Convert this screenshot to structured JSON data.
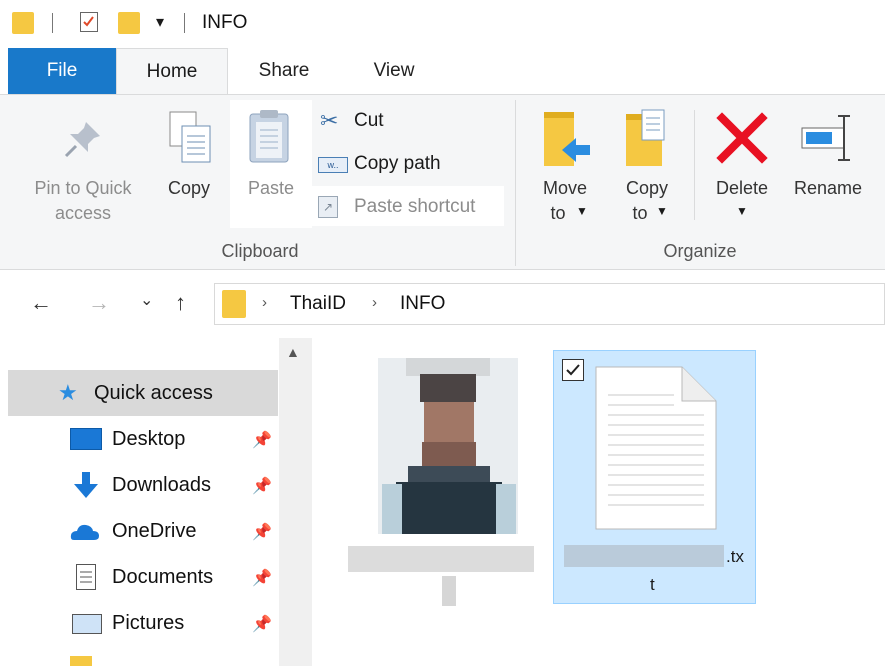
{
  "title": "INFO",
  "tabs": {
    "file": "File",
    "home": "Home",
    "share": "Share",
    "view": "View"
  },
  "ribbon": {
    "pin_quick_access": {
      "line1": "Pin to Quick",
      "line2": "access"
    },
    "copy": "Copy",
    "paste": "Paste",
    "cut": "Cut",
    "copy_path": "Copy path",
    "paste_shortcut": "Paste shortcut",
    "clipboard_group": "Clipboard",
    "move_to": {
      "line1": "Move",
      "line2": "to"
    },
    "copy_to": {
      "line1": "Copy",
      "line2": "to"
    },
    "delete": "Delete",
    "rename": "Rename",
    "organize_group": "Organize"
  },
  "breadcrumb": [
    "ThaiID",
    "INFO"
  ],
  "nav": {
    "quick_access": "Quick access",
    "items": [
      {
        "label": "Desktop",
        "icon": "desktop-icon"
      },
      {
        "label": "Downloads",
        "icon": "downloads-icon"
      },
      {
        "label": "OneDrive",
        "icon": "onedrive-icon"
      },
      {
        "label": "Documents",
        "icon": "documents-icon"
      },
      {
        "label": "Pictures",
        "icon": "pictures-icon"
      }
    ]
  },
  "files": [
    {
      "name_visible_line1": ".tx",
      "name_visible_line2": "t",
      "selected": true
    }
  ],
  "colors": {
    "file_tab": "#1979ca",
    "selection": "#cce8ff",
    "delete_red": "#e81123",
    "folder": "#f5c842"
  }
}
